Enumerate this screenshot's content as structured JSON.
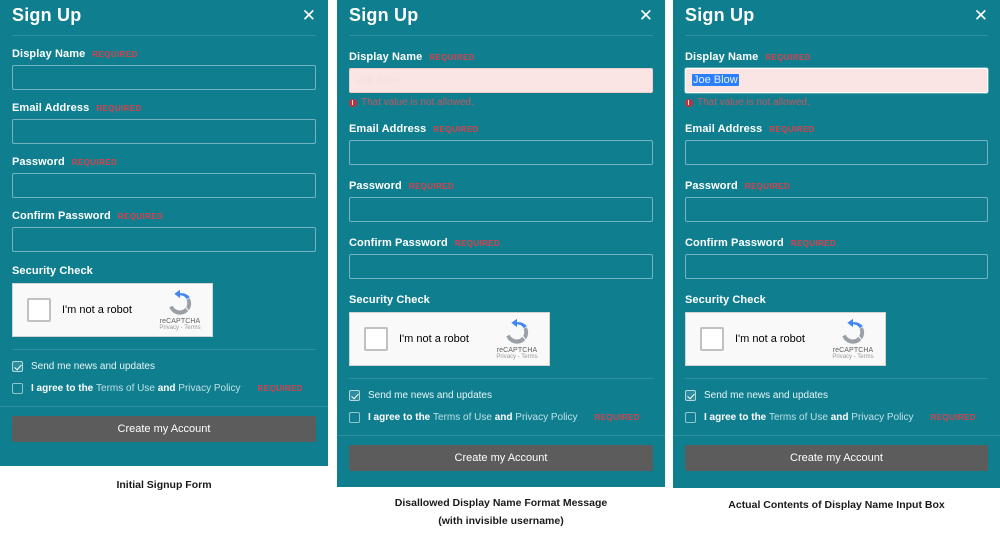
{
  "colors": {
    "panel_teal": "#0f7f90",
    "required_red": "#d9414a",
    "error_text": "#c2565f",
    "error_field_bg": "#fbe4e4",
    "submit_gray": "#5c5c5c",
    "selection_blue": "#2a7fff",
    "link_color": "#bfe0e6"
  },
  "modal": {
    "title": "Sign Up",
    "close_icon": "close-icon",
    "required_tag": "REQUIRED",
    "fields": {
      "display_name": "Display Name",
      "email": "Email Address",
      "password": "Password",
      "confirm_password": "Confirm Password"
    },
    "security_check_label": "Security Check",
    "captcha": {
      "checkbox_label": "I'm not a robot",
      "brand": "reCAPTCHA",
      "links": "Privacy - Terms"
    },
    "options": {
      "newsletter": "Send me news and updates",
      "terms_prefix": "I agree to the",
      "terms_link": "Terms of Use",
      "terms_joiner": "and",
      "privacy_link": "Privacy Policy",
      "terms_required": "REQUIRED"
    },
    "submit_label": "Create my Account"
  },
  "panels": [
    {
      "id": "initial",
      "display_name_value": "",
      "display_name_state": "empty",
      "error_message": "",
      "caption_line1": "Initial Signup Form",
      "caption_line2": ""
    },
    {
      "id": "error-invisible",
      "display_name_value": "Joe Blow",
      "display_name_state": "error-invisible-text",
      "error_message": "That value is not allowed.",
      "caption_line1": "Disallowed Display Name Format Message",
      "caption_line2": "(with invisible username)"
    },
    {
      "id": "error-selected",
      "display_name_value": "Joe Blow",
      "display_name_state": "error-text-selected",
      "error_message": "That value is not allowed.",
      "caption_line1": "Actual Contents of Display Name Input Box",
      "caption_line2": ""
    }
  ]
}
